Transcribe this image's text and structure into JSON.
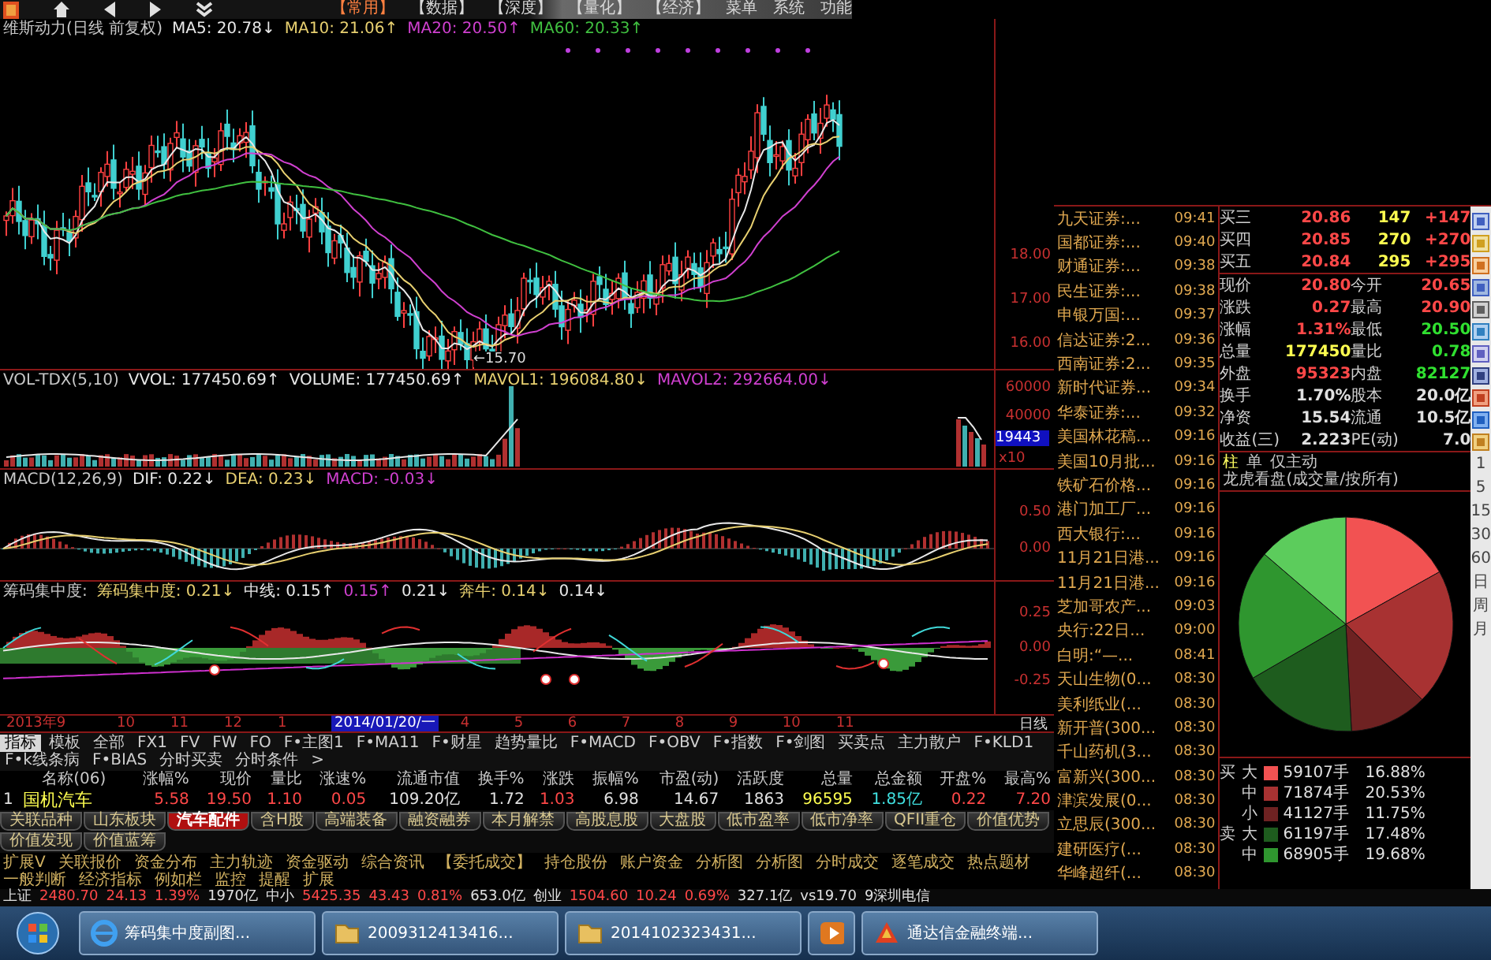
{
  "top_bar": {
    "menus": [
      {
        "label": "【常用】",
        "selected": true
      },
      {
        "label": "【数据】",
        "selected": false
      },
      {
        "label": "【深度】",
        "selected": false
      },
      {
        "label": "【量化】",
        "selected": false
      },
      {
        "label": "【经济】",
        "selected": false
      },
      {
        "label": "菜单",
        "selected": false
      },
      {
        "label": "系统",
        "selected": false
      },
      {
        "label": "功能",
        "selected": false
      }
    ]
  },
  "panes": [
    {
      "kind": "price",
      "legend": [
        {
          "text": "维斯动力(日线 前复权)",
          "color": "#c8c8c8"
        },
        {
          "text": "MA5: 20.78↓",
          "color": "#e8e8e8"
        },
        {
          "text": "MA10: 21.06↑",
          "color": "#e8d070"
        },
        {
          "text": "MA20: 20.50↑",
          "color": "#d040d0"
        },
        {
          "text": "MA60: 20.33↑",
          "color": "#40c040"
        }
      ],
      "axis": [
        "18.00",
        "17.00",
        "16.00"
      ],
      "low_mark": "←15.70"
    },
    {
      "kind": "volume",
      "legend": [
        {
          "text": "VOL-TDX(5,10)",
          "color": "#c8c8c8"
        },
        {
          "text": "VVOL: 177450.69↑",
          "color": "#e8e8e8"
        },
        {
          "text": "VOLUME: 177450.69↑",
          "color": "#e8e8e8"
        },
        {
          "text": "MAVOL1: 196084.80↓",
          "color": "#e8d070"
        },
        {
          "text": "MAVOL2: 292664.00↓",
          "color": "#d040d0"
        }
      ],
      "axis": [
        "60000",
        "40000"
      ],
      "cursor_value": "19443",
      "unit": "x10"
    },
    {
      "kind": "macd",
      "legend": [
        {
          "text": "MACD(12,26,9)",
          "color": "#c8c8c8"
        },
        {
          "text": "DIF: 0.22↓",
          "color": "#e8e8e8"
        },
        {
          "text": "DEA: 0.23↓",
          "color": "#e8d070"
        },
        {
          "text": "MACD: -0.03↓",
          "color": "#d040d0"
        }
      ],
      "axis": [
        "0.50",
        "0.00"
      ]
    },
    {
      "kind": "chip",
      "legend": [
        {
          "text": "筹码集中度:",
          "color": "#c8c8c8"
        },
        {
          "text": "筹码集中度: 0.21↓",
          "color": "#e8d070"
        },
        {
          "text": "中线: 0.15↑",
          "color": "#e8e8e8"
        },
        {
          "text": "0.15↑",
          "color": "#d040d0"
        },
        {
          "text": "0.21↓",
          "color": "#e8e8e8"
        },
        {
          "text": "奔牛: 0.14↓",
          "color": "#e8d070"
        },
        {
          "text": "0.14↓",
          "color": "#e8e8e8"
        }
      ],
      "axis": [
        "0.25",
        "0.00",
        "-0.25"
      ]
    }
  ],
  "date_axis": {
    "labels": [
      "2013年9",
      "10",
      "11",
      "12",
      "1"
    ],
    "cursor": "2014/01/20/一",
    "labels_after": [
      "4",
      "5",
      "6",
      "7",
      "8",
      "9",
      "10",
      "11"
    ],
    "period": "日线"
  },
  "indicator_tabs": [
    {
      "label": "指标",
      "selected": true
    },
    {
      "label": "模板",
      "selected": false
    },
    {
      "label": "全部",
      "selected": false
    },
    {
      "label": "FX1",
      "selected": false
    },
    {
      "label": "FV",
      "selected": false
    },
    {
      "label": "FW",
      "selected": false
    },
    {
      "label": "FO",
      "selected": false
    },
    {
      "label": "F•主图1",
      "selected": false
    },
    {
      "label": "F•MA11",
      "selected": false
    },
    {
      "label": "F•财星",
      "selected": false
    },
    {
      "label": "趋势量比",
      "selected": false
    },
    {
      "label": "F•MACD",
      "selected": false
    },
    {
      "label": "F•OBV",
      "selected": false
    },
    {
      "label": "F•指数",
      "selected": false
    },
    {
      "label": "F•剑图",
      "selected": false
    },
    {
      "label": "买卖点",
      "selected": false
    },
    {
      "label": "主力散户",
      "selected": false
    },
    {
      "label": "F•KLD1",
      "selected": false
    },
    {
      "label": "F•k线条病",
      "selected": false
    },
    {
      "label": "F•BIAS",
      "selected": false
    },
    {
      "label": "分时买卖",
      "selected": false
    },
    {
      "label": "分时条件",
      "selected": false
    },
    {
      "label": ">",
      "selected": false
    }
  ],
  "table": {
    "columns": [
      "",
      "名称(06)",
      "涨幅%",
      "现价",
      "量比",
      "涨速%",
      "流通市值",
      "换手%",
      "涨跌",
      "振幅%",
      "市盈(动)",
      "活跃度",
      "总量",
      "总金额",
      "开盘%",
      "最高%"
    ],
    "rows": [
      {
        "cells": [
          {
            "text": "1",
            "color": "#e0e0e0"
          },
          {
            "text": "国机汽车",
            "color": "#ffff50"
          },
          {
            "text": "5.58",
            "color": "#ff4848"
          },
          {
            "text": "19.50",
            "color": "#ff4848"
          },
          {
            "text": "1.10",
            "color": "#ff4848"
          },
          {
            "text": "0.05",
            "color": "#ff4848"
          },
          {
            "text": "109.20亿",
            "color": "#e0e0e0"
          },
          {
            "text": "1.72",
            "color": "#e0e0e0"
          },
          {
            "text": "1.03",
            "color": "#ff4848"
          },
          {
            "text": "6.98",
            "color": "#e0e0e0"
          },
          {
            "text": "14.67",
            "color": "#e0e0e0"
          },
          {
            "text": "1863",
            "color": "#e0e0e0"
          },
          {
            "text": "96595",
            "color": "#ffff50"
          },
          {
            "text": "1.85亿",
            "color": "#40e0e0"
          },
          {
            "text": "0.22",
            "color": "#ff4848"
          },
          {
            "text": "7.20",
            "color": "#ff4848"
          }
        ]
      }
    ]
  },
  "sector_tabs": [
    {
      "label": "关联品种",
      "selected": false
    },
    {
      "label": "山东板块",
      "selected": false
    },
    {
      "label": "汽车配件",
      "selected": true
    },
    {
      "label": "含H股",
      "selected": false
    },
    {
      "label": "高端装备",
      "selected": false
    },
    {
      "label": "融资融券",
      "selected": false
    },
    {
      "label": "本月解禁",
      "selected": false
    },
    {
      "label": "高股息股",
      "selected": false
    },
    {
      "label": "大盘股",
      "selected": false
    },
    {
      "label": "低市盈率",
      "selected": false
    },
    {
      "label": "低市净率",
      "selected": false
    },
    {
      "label": "QFII重仓",
      "selected": false
    },
    {
      "label": "价值优势",
      "selected": false
    },
    {
      "label": "价值发现",
      "selected": false
    },
    {
      "label": "价值蓝筹",
      "selected": false
    }
  ],
  "function_bar": [
    "扩展V",
    "关联报价",
    "资金分布",
    "主力轨迹",
    "资金驱动",
    "综合资讯",
    "【委托成交】",
    "持仓股份",
    "账户资金",
    "分析图",
    "分析图",
    "分时成交",
    "逐笔成交",
    "热点题材",
    "一般判断",
    "经济指标",
    "例如栏",
    "监控",
    "提醒",
    "扩展"
  ],
  "news": [
    {
      "title": "九天证券:...",
      "time": "09:41"
    },
    {
      "title": "国都证券:...",
      "time": "09:40"
    },
    {
      "title": "财通证券:...",
      "time": "09:38"
    },
    {
      "title": "民生证券:...",
      "time": "09:38"
    },
    {
      "title": "申银万国:...",
      "time": "09:37"
    },
    {
      "title": "信达证券:2...",
      "time": "09:36"
    },
    {
      "title": "西南证券:2...",
      "time": "09:35"
    },
    {
      "title": "新时代证券...",
      "time": "09:34"
    },
    {
      "title": "华泰证券:...",
      "time": "09:32"
    },
    {
      "title": "美国林花稿...",
      "time": "09:16"
    },
    {
      "title": "美国10月批...",
      "time": "09:16"
    },
    {
      "title": "铁矿石价格...",
      "time": "09:16"
    },
    {
      "title": "港门加工厂...",
      "time": "09:16"
    },
    {
      "title": "西大银行:...",
      "time": "09:16"
    },
    {
      "title": "11月21日港...",
      "time": "09:16"
    },
    {
      "title": "11月21日港...",
      "time": "09:16"
    },
    {
      "title": "芝加哥农产...",
      "time": "09:03"
    },
    {
      "title": "央行:22日...",
      "time": "09:00"
    },
    {
      "title": "白明:“—...",
      "time": "08:41"
    },
    {
      "title": "天山生物(0...",
      "time": "08:30"
    },
    {
      "title": "美利纸业(...",
      "time": "08:30"
    },
    {
      "title": "新开普(300...",
      "time": "08:30"
    },
    {
      "title": "千山药机(3...",
      "time": "08:30"
    },
    {
      "title": "富新兴(300...",
      "time": "08:30"
    },
    {
      "title": "津滨发展(0...",
      "time": "08:30"
    },
    {
      "title": "立思辰(300...",
      "time": "08:30"
    },
    {
      "title": "建研医疗(...",
      "time": "08:30"
    },
    {
      "title": "华峰超纤(...",
      "time": "08:30"
    }
  ],
  "quote": {
    "bids": [
      {
        "label": "买三",
        "price": "20.86",
        "volume": "147",
        "change": "+147"
      },
      {
        "label": "买四",
        "price": "20.85",
        "volume": "270",
        "change": "+270"
      },
      {
        "label": "买五",
        "price": "20.84",
        "volume": "295",
        "change": "+295"
      }
    ],
    "stats": [
      {
        "cells": [
          {
            "label": "现价",
            "value": "20.80",
            "color": "#ff4848"
          },
          {
            "label": "今开",
            "value": "20.65",
            "color": "#ff4848"
          }
        ]
      },
      {
        "cells": [
          {
            "label": "涨跌",
            "value": "0.27",
            "color": "#ff4848"
          },
          {
            "label": "最高",
            "value": "20.90",
            "color": "#ff4848"
          }
        ]
      },
      {
        "cells": [
          {
            "label": "涨幅",
            "value": "1.31%",
            "color": "#ff4848"
          },
          {
            "label": "最低",
            "value": "20.50",
            "color": "#30e030"
          }
        ]
      },
      {
        "cells": [
          {
            "label": "总量",
            "value": "177450",
            "color": "#ffff50"
          },
          {
            "label": "量比",
            "value": "0.78",
            "color": "#30e030"
          }
        ]
      },
      {
        "cells": [
          {
            "label": "外盘",
            "value": "95323",
            "color": "#ff4848"
          },
          {
            "label": "内盘",
            "value": "82127",
            "color": "#30e030"
          }
        ]
      },
      {
        "cells": [
          {
            "label": "换手",
            "value": "1.70%",
            "color": "#e0e0e0"
          },
          {
            "label": "股本",
            "value": "20.0亿",
            "color": "#e0e0e0"
          }
        ]
      },
      {
        "cells": [
          {
            "label": "净资",
            "value": "15.54",
            "color": "#e0e0e0"
          },
          {
            "label": "流通",
            "value": "10.5亿",
            "color": "#e0e0e0"
          }
        ]
      },
      {
        "cells": [
          {
            "label": "收益(三)",
            "value": "2.223",
            "color": "#e0e0e0"
          },
          {
            "label": "PE(动)",
            "value": "7.0",
            "color": "#e0e0e0"
          }
        ]
      }
    ],
    "tabs": [
      {
        "label": "柱",
        "selected": true
      },
      {
        "label": "单",
        "selected": false
      },
      {
        "label": "仅主动",
        "selected": false
      },
      {
        "label": "龙虎看盘(成交量/按所有)",
        "selected": false
      }
    ],
    "chart_data": {
      "type": "pie",
      "series": [
        {
          "values": [
            16.88,
            20.53,
            11.75,
            17.48,
            19.68,
            13.68
          ]
        }
      ],
      "colors": [
        "#f25252",
        "#a83232",
        "#6e2222",
        "#1e5c1e",
        "#2f962f",
        "#5ccc5c"
      ]
    },
    "legend": [
      {
        "side": "买",
        "size": "大",
        "volume": "59107手",
        "share": "16.88%",
        "color": "#f25252"
      },
      {
        "size": "中",
        "volume": "71874手",
        "share": "20.53%",
        "color": "#a83232"
      },
      {
        "size": "小",
        "volume": "41127手",
        "share": "11.75%",
        "color": "#6e2222"
      },
      {
        "side": "卖",
        "size": "大",
        "volume": "61197手",
        "share": "17.48%",
        "color": "#1e5c1e"
      },
      {
        "size": "中",
        "volume": "68905手",
        "share": "19.68%",
        "color": "#2f962f"
      }
    ]
  },
  "side_toolbar": {
    "periods": [
      "1",
      "5",
      "15",
      "30",
      "60",
      "日",
      "周",
      "月"
    ]
  },
  "status_bar": [
    {
      "text": "上证",
      "color": "#e0e0e0"
    },
    {
      "text": "2480.70",
      "color": "#ff4848"
    },
    {
      "text": "24.13",
      "color": "#ff4848"
    },
    {
      "text": "1.39%",
      "color": "#ff4848"
    },
    {
      "text": "1970亿",
      "color": "#e0e0e0"
    },
    {
      "text": "中小",
      "color": "#e0e0e0"
    },
    {
      "text": "5425.35",
      "color": "#ff4848"
    },
    {
      "text": "43.43",
      "color": "#ff4848"
    },
    {
      "text": "0.81%",
      "color": "#ff4848"
    },
    {
      "text": "653.0亿",
      "color": "#e0e0e0"
    },
    {
      "text": "创业",
      "color": "#e0e0e0"
    },
    {
      "text": "1504.60",
      "color": "#ff4848"
    },
    {
      "text": "10.24",
      "color": "#ff4848"
    },
    {
      "text": "0.69%",
      "color": "#ff4848"
    },
    {
      "text": "327.1亿",
      "color": "#e0e0e0"
    },
    {
      "text": "vs19.70",
      "color": "#e0e0e0"
    },
    {
      "text": "9深圳电信",
      "color": "#e0e0e0"
    }
  ],
  "taskbar": [
    {
      "kind": "browser",
      "label": "筹码集中度副图..."
    },
    {
      "kind": "folder",
      "label": "2009312413416..."
    },
    {
      "kind": "folder",
      "label": "2014102323431..."
    },
    {
      "kind": "media"
    },
    {
      "kind": "app",
      "label": "通达信金融终端..."
    }
  ]
}
